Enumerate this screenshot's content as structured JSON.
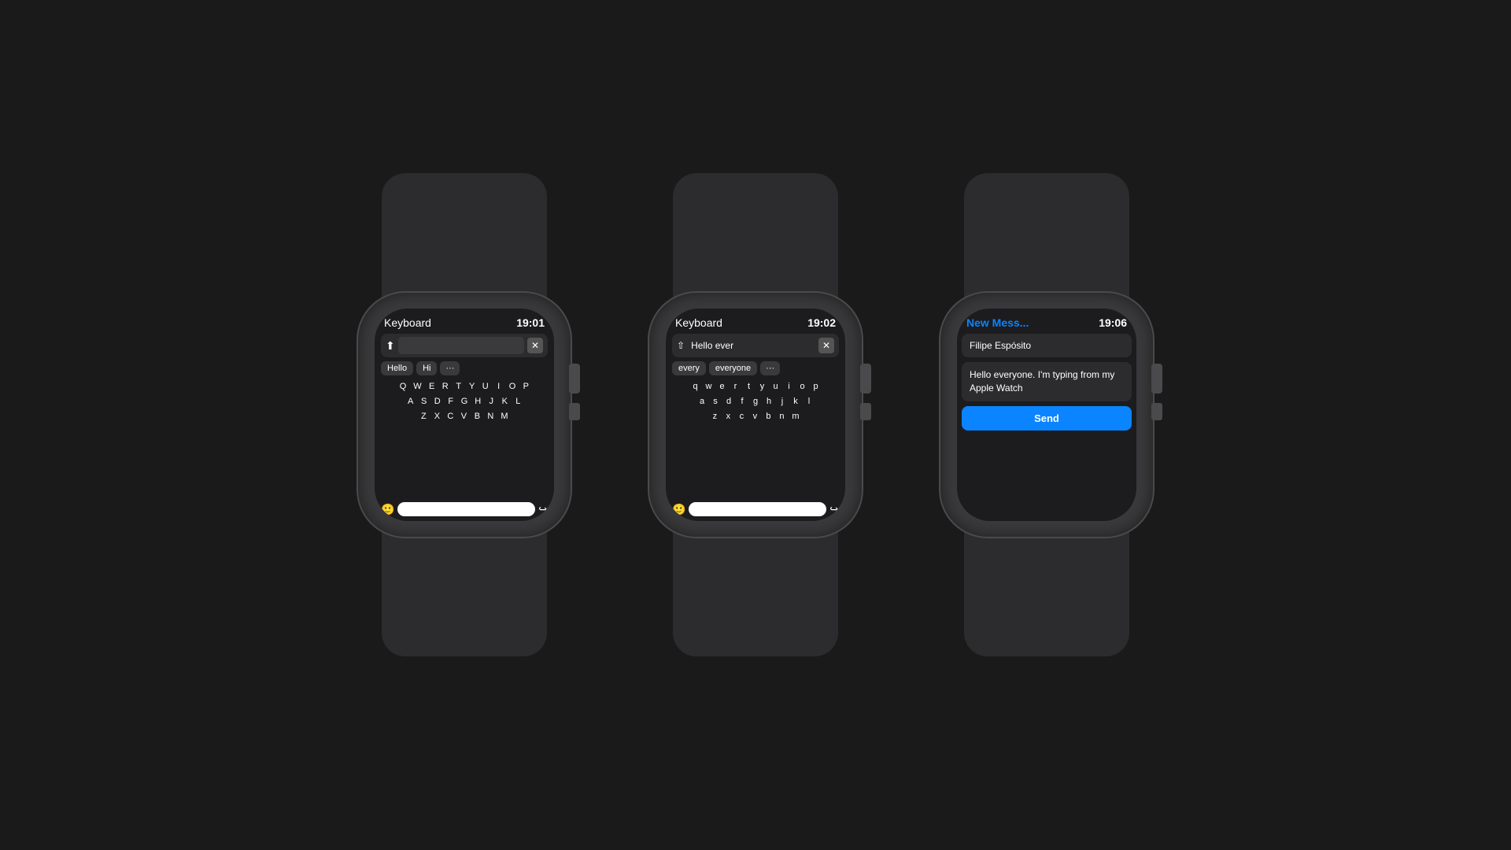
{
  "background": "#1a1a1a",
  "watches": [
    {
      "id": "watch1",
      "screen_type": "keyboard_empty",
      "header": {
        "title": "Keyboard",
        "time": "19:01"
      },
      "input": {
        "has_text": false,
        "text": ""
      },
      "suggestions": [
        "Hello",
        "Hi",
        "···"
      ],
      "keyboard_rows": [
        [
          "Q",
          "W",
          "E",
          "R",
          "T",
          "Y",
          "U",
          "I",
          "O",
          "P"
        ],
        [
          "A",
          "S",
          "D",
          "F",
          "G",
          "H",
          "J",
          "K",
          "L"
        ],
        [
          "Z",
          "X",
          "C",
          "V",
          "B",
          "N",
          "M"
        ]
      ],
      "case": "upper"
    },
    {
      "id": "watch2",
      "screen_type": "keyboard_typing",
      "header": {
        "title": "Keyboard",
        "time": "19:02"
      },
      "input": {
        "has_text": true,
        "text": "Hello ever"
      },
      "suggestions": [
        "every",
        "everyone",
        "···"
      ],
      "keyboard_rows": [
        [
          "q",
          "w",
          "e",
          "r",
          "t",
          "y",
          "u",
          "i",
          "o",
          "p"
        ],
        [
          "a",
          "s",
          "d",
          "f",
          "g",
          "h",
          "j",
          "k",
          "l"
        ],
        [
          "z",
          "x",
          "c",
          "v",
          "b",
          "n",
          "m"
        ]
      ],
      "case": "lower"
    },
    {
      "id": "watch3",
      "screen_type": "message",
      "header": {
        "title": "New Mess...",
        "time": "19:06"
      },
      "recipient": "Filipe Espósito",
      "message": "Hello everyone. I'm typing from my Apple Watch",
      "send_label": "Send"
    }
  ]
}
